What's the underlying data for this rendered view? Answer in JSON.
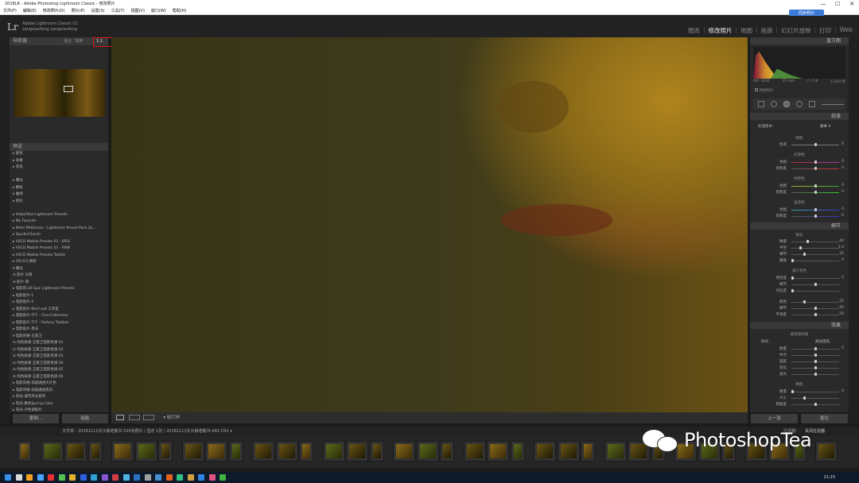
{
  "window": {
    "title": "2018LR - Adobe Photoshop Lightroom Classic - 修改照片",
    "controls": [
      "—",
      "☐",
      "✕"
    ]
  },
  "menu": [
    "文件(F)",
    "编辑(E)",
    "修改照片(D)",
    "照片(P)",
    "设置(S)",
    "工具(T)",
    "视图(V)",
    "窗口(W)",
    "帮助(H)"
  ],
  "identity": {
    "logo": "Lr",
    "line1": "Adobe Lightroom Classic CC",
    "line2": "zangxiaofeng zangxiaofeng"
  },
  "cloud_button": "同步照片",
  "modules": [
    "图库",
    "修改照片",
    "地图",
    "画册",
    "幻灯片放映",
    "打印",
    "Web"
  ],
  "active_module": "修改照片",
  "left_panel": {
    "navigator_title": "导航器",
    "nav_zoom": [
      "适合",
      "填满",
      "1:1"
    ],
    "presets_title": "预设",
    "presets": [
      "▸ 颜色",
      "▸ 效果",
      "▸ 黑白",
      "",
      "▸ 曝光",
      "▸ 颗粒",
      "▸ 曲线",
      "▸ 锐化",
      "",
      "▸ HubaFilter-Lightroom Presets",
      "▸ My Favorite",
      "▸ Peter McKinnon - Lightroom Preset Pack 2k...",
      "▸ SpyderCheckr",
      "▸ VSCO Mobile Presets 01 - JPEG",
      "▸ VSCO Mobile Presets 01 - RAW",
      "▸ VSCO Mobile Presets Toolkit",
      "▸ VSCO小清新",
      "▾ 曝光",
      "   ⊘ 胶片 日系",
      "   ⊘ 胶片 褐",
      "▸ 电影风-20 Epic Lightroom Presets",
      "▸ 电影胶片-1",
      "▸ 电影胶片-2",
      "▸ 电影胶片-Red Leaf 工作室",
      "▸ 电影胶片-TFF - Cine Collection",
      "▸ 电影胶片-TFF - Factory Toolbox",
      "▸ 电影胶片-黑白",
      "▾ 电影风格-王家卫",
      "   ⊘ 纯色质感-王家卫电影色调 01",
      "   ⊘ 纯色质感-王家卫电影色调 02",
      "   ⊘ 纯色质感-王家卫电影色调 03",
      "   ⊘ 纯色质感-王家卫电影色调 04",
      "   ⊘ 纯色质感-王家卫电影色调 05",
      "   ⊘ 纯色质感-王家卫电影色调 06",
      "▸ 电影风格-高级通透大片色",
      "▸ 电影风格-高级通透黑白",
      "▸ 风光-城市风光系列",
      "▸ 风光-春色Spring Color",
      "▸ 风光-冷色调胶片"
    ],
    "copy_button": "复制...",
    "paste_button": "粘贴"
  },
  "toolbar": {
    "label": "▾ 软打样"
  },
  "right_panel": {
    "histogram_title": "直方图",
    "histo_info": [
      "ISO 3200",
      "35 mm",
      "f / 2.8",
      "1/160 秒"
    ],
    "original_label": "原始照片",
    "calibration_title": "校准",
    "process_label": "处理版本：",
    "process_value": "版本 4",
    "shadows_title": "阴影",
    "sliders": [
      {
        "label": "色调",
        "value": "0",
        "group": "shadow"
      },
      {
        "label": "色相",
        "value": "0",
        "group": "red"
      },
      {
        "label": "饱和度",
        "value": "0",
        "group": "red"
      },
      {
        "label": "色相",
        "value": "0",
        "group": "green"
      },
      {
        "label": "饱和度",
        "value": "0",
        "group": "green"
      },
      {
        "label": "色相",
        "value": "0",
        "group": "blue"
      },
      {
        "label": "饱和度",
        "value": "0",
        "group": "blue"
      }
    ],
    "primary_red": "红原色",
    "primary_green": "绿原色",
    "primary_blue": "蓝原色",
    "detail_title": "细节",
    "sharpen_label": "锐化",
    "sharpen_sliders": [
      {
        "label": "数量",
        "value": "40",
        "pos": 0.32
      },
      {
        "label": "半径",
        "value": "1.0",
        "pos": 0.18
      },
      {
        "label": "细节",
        "value": "25",
        "pos": 0.25
      },
      {
        "label": "蒙版",
        "value": "0",
        "pos": 0.0
      }
    ],
    "noise_label": "减少杂色",
    "noise_sliders": [
      {
        "label": "明亮度",
        "value": "0",
        "pos": 0.0
      },
      {
        "label": "细节",
        "value": "",
        "pos": 0.5
      },
      {
        "label": "对比度",
        "value": "",
        "pos": 0.0
      },
      {
        "label": "颜色",
        "value": "25",
        "pos": 0.25
      },
      {
        "label": "细节",
        "value": "50",
        "pos": 0.5
      },
      {
        "label": "平滑度",
        "value": "50",
        "pos": 0.5
      }
    ],
    "effects_title": "效果",
    "vignette_label": "裁剪后暗角",
    "vignette_style_label": "样式：",
    "vignette_style": "高光优先",
    "vignette_sliders": [
      {
        "label": "数量",
        "value": "0",
        "pos": 0.5
      },
      {
        "label": "中点",
        "value": "",
        "pos": 0.5
      },
      {
        "label": "圆度",
        "value": "",
        "pos": 0.5
      },
      {
        "label": "羽化",
        "value": "",
        "pos": 0.5
      },
      {
        "label": "高光",
        "value": "",
        "pos": 0.5
      }
    ],
    "grain_label": "颗粒",
    "grain_sliders": [
      {
        "label": "数量",
        "value": "0",
        "pos": 0.0
      },
      {
        "label": "大小",
        "value": "",
        "pos": 0.25
      },
      {
        "label": "粗糙度",
        "value": "",
        "pos": 0.5
      }
    ],
    "prev_button": "上一张",
    "reset_button": "复位"
  },
  "filmstrip": {
    "header": "文件夹：20181111长沙晨老酸书    520张照片 / 选定 1张 / 20181111长沙晨老酸书-492.CR2 ▾",
    "filter_label": "过滤器：",
    "filter_value": "关闭过滤器"
  },
  "watermark": "PhotoshopTea",
  "taskbar": {
    "clock": "21:23"
  }
}
